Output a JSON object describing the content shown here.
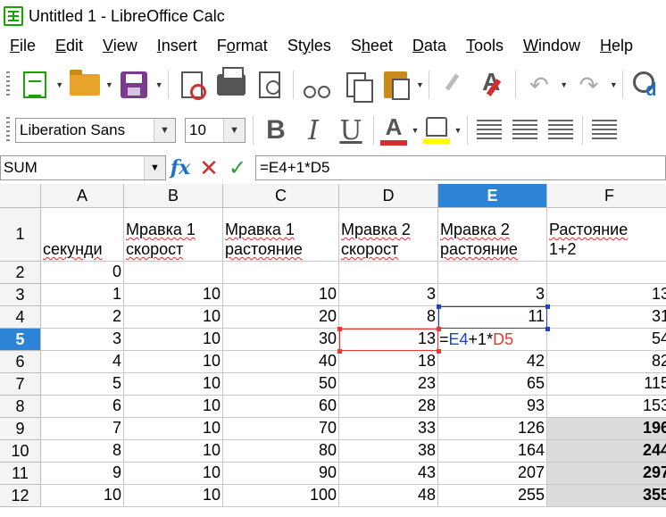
{
  "window": {
    "title": "Untitled 1 - LibreOffice Calc"
  },
  "menu": [
    {
      "label": "File",
      "mnemonic": "F",
      "rest": "ile"
    },
    {
      "label": "Edit",
      "mnemonic": "E",
      "rest": "dit"
    },
    {
      "label": "View",
      "mnemonic": "V",
      "rest": "iew"
    },
    {
      "label": "Insert",
      "mnemonic": "I",
      "rest": "nsert"
    },
    {
      "label": "Format",
      "pre": "F",
      "mnemonic": "o",
      "rest": "rmat"
    },
    {
      "label": "Styles",
      "pre": "St",
      "mnemonic": "y",
      "rest": "les"
    },
    {
      "label": "Sheet",
      "pre": "S",
      "mnemonic": "h",
      "rest": "eet"
    },
    {
      "label": "Data",
      "mnemonic": "D",
      "rest": "ata"
    },
    {
      "label": "Tools",
      "mnemonic": "T",
      "rest": "ools"
    },
    {
      "label": "Window",
      "mnemonic": "W",
      "rest": "indow"
    },
    {
      "label": "Help",
      "mnemonic": "H",
      "rest": "elp"
    }
  ],
  "toolbar": {
    "icons": [
      "new-spreadsheet-icon",
      "open-folder-icon",
      "save-icon",
      "export-pdf-icon",
      "print-icon",
      "print-preview-icon",
      "cut-icon",
      "copy-icon",
      "paste-icon",
      "clone-formatting-icon",
      "clear-formatting-icon",
      "undo-icon",
      "redo-icon",
      "find-replace-icon"
    ]
  },
  "format": {
    "font_name": "Liberation Sans",
    "font_size": "10",
    "bold_label": "B",
    "italic_label": "I",
    "underline_label": "U",
    "font_color_label": "A",
    "font_color": "#d32f2f",
    "highlight_color": "#ffff00"
  },
  "formula_bar": {
    "name_box": "SUM",
    "fx_label": "fx",
    "formula": "=E4+1*D5"
  },
  "sheet": {
    "columns": [
      "A",
      "B",
      "C",
      "D",
      "E",
      "F"
    ],
    "active_column": "E",
    "active_row": "5",
    "header_row": {
      "row": "1",
      "A": "секунди",
      "B": "Мравка 1 скорост",
      "B1": "Мравка 1",
      "B2": "скорост",
      "C1": "Мравка 1",
      "C2": "растояние",
      "D1": "Мравка 2",
      "D2": "скорост",
      "E1": "Мравка 2",
      "E2": "растояние",
      "F1": "Растояние",
      "F2": "1+2"
    },
    "rows": [
      {
        "row": "2",
        "A": "0",
        "B": "",
        "C": "",
        "D": "",
        "E": "",
        "F": ""
      },
      {
        "row": "3",
        "A": "1",
        "B": "10",
        "C": "10",
        "D": "3",
        "E": "3",
        "F": "13"
      },
      {
        "row": "4",
        "A": "2",
        "B": "10",
        "C": "20",
        "D": "8",
        "E": "11",
        "F": "31"
      },
      {
        "row": "5",
        "A": "3",
        "B": "10",
        "C": "30",
        "D": "13",
        "E": "",
        "F": "54"
      },
      {
        "row": "6",
        "A": "4",
        "B": "10",
        "C": "40",
        "D": "18",
        "E": "42",
        "F": "82"
      },
      {
        "row": "7",
        "A": "5",
        "B": "10",
        "C": "50",
        "D": "23",
        "E": "65",
        "F": "115"
      },
      {
        "row": "8",
        "A": "6",
        "B": "10",
        "C": "60",
        "D": "28",
        "E": "93",
        "F": "153"
      },
      {
        "row": "9",
        "A": "7",
        "B": "10",
        "C": "70",
        "D": "33",
        "E": "126",
        "F": "196"
      },
      {
        "row": "10",
        "A": "8",
        "B": "10",
        "C": "80",
        "D": "38",
        "E": "164",
        "F": "244"
      },
      {
        "row": "11",
        "A": "9",
        "B": "10",
        "C": "90",
        "D": "43",
        "E": "207",
        "F": "297"
      },
      {
        "row": "12",
        "A": "10",
        "B": "10",
        "C": "100",
        "D": "48",
        "E": "255",
        "F": "355"
      }
    ],
    "shaded_rows": [
      "9",
      "10",
      "11",
      "12"
    ],
    "editing": {
      "cell": "E5",
      "part1": "=",
      "part2": "E4",
      "part3": "+1*",
      "part4": "D5"
    },
    "colors": {
      "selection": "#2d83d6",
      "ref_e4": "#2040d0",
      "ref_d5": "#e53935",
      "shaded": "#dcdcdc"
    }
  }
}
